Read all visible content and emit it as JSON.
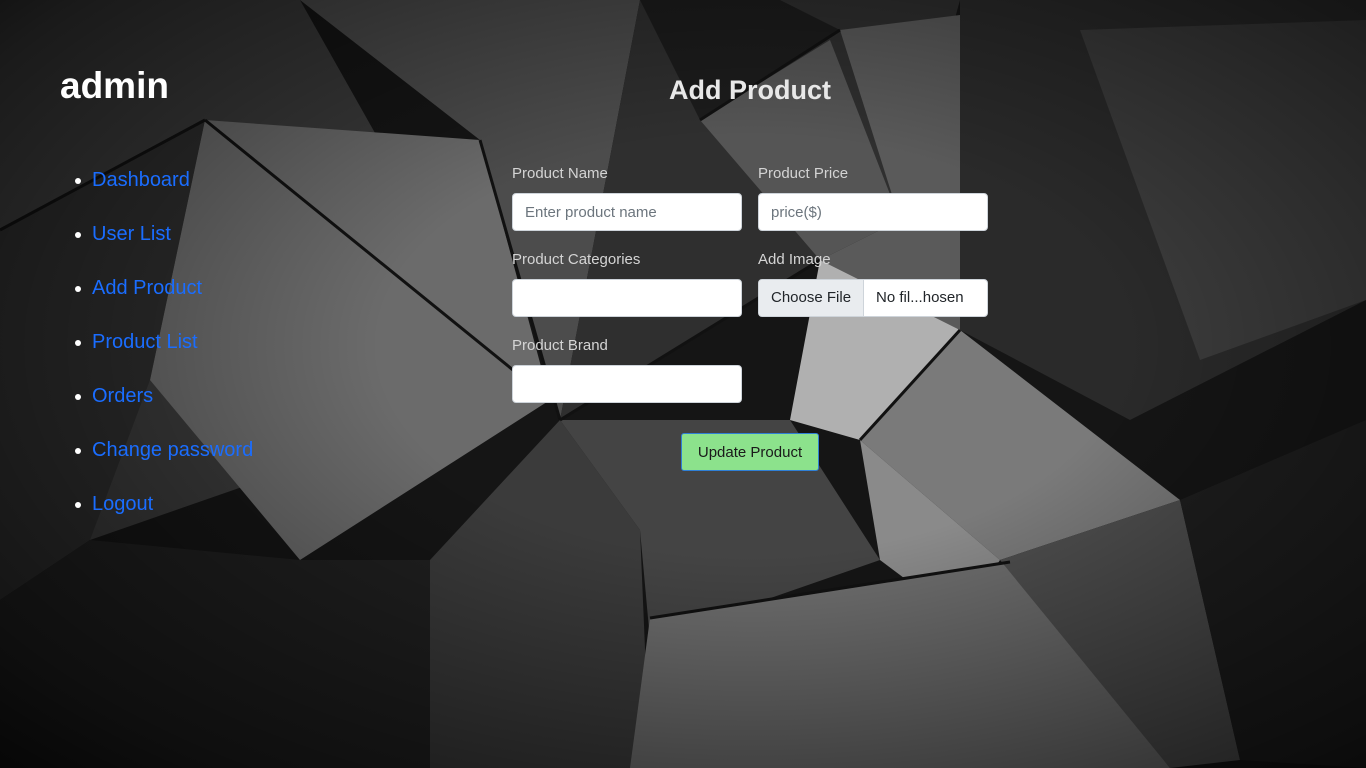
{
  "sidebar": {
    "brand": "admin",
    "items": [
      {
        "label": "Dashboard"
      },
      {
        "label": "User List"
      },
      {
        "label": "Add Product"
      },
      {
        "label": "Product List"
      },
      {
        "label": "Orders"
      },
      {
        "label": "Change password"
      },
      {
        "label": "Logout"
      }
    ],
    "link_color": "#1a6dff"
  },
  "main": {
    "title": "Add Product",
    "form": {
      "product_name": {
        "label": "Product Name",
        "placeholder": "Enter product name",
        "value": ""
      },
      "product_price": {
        "label": "Product Price",
        "placeholder": "price($)",
        "value": ""
      },
      "product_categories": {
        "label": "Product Categories",
        "value": ""
      },
      "add_image": {
        "label": "Add Image",
        "button_label": "Choose File",
        "file_name": "No fil...hosen"
      },
      "product_brand": {
        "label": "Product Brand",
        "value": ""
      },
      "submit_label": "Update Product",
      "submit_color": "#8ce28c"
    }
  }
}
